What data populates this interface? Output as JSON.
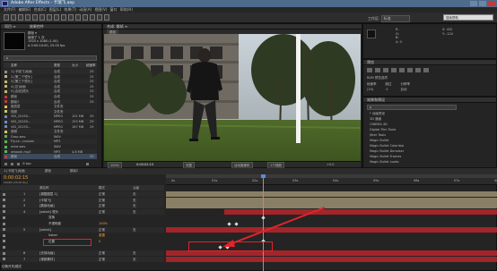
{
  "titlebar": {
    "title": "Adobe After Effects - 卡瑞飞.aep"
  },
  "menubar": {
    "text": "文件(F) 编辑(E) 合成(C) 图层(L) 效果(T) 动画(A) 视图(V) 窗口 帮助(H)"
  },
  "toolbar": {
    "workspace_label": "工作区:",
    "workspace_value": "标准",
    "search_placeholder": "搜索帮助"
  },
  "project": {
    "tab": "项目 ≡",
    "tab2": "效果控件",
    "selected_name": "跳帧 ▾",
    "selected_info": "使用了 1 次",
    "selected_dims": "1920 x 1080 (1.00)",
    "selected_dur": "Δ 0:00:10:00, 25.00 fps",
    "search_placeholder": "ρ",
    "col_name": "名称",
    "col_type": "类型",
    "col_size": "大小",
    "col_rate": "帧速率",
    "items": [
      {
        "name": "1.[卡瑞飞]动画",
        "type": "合成",
        "size": "",
        "rate": "25",
        "color": "#8e8e8e"
      },
      {
        "name": "2.[第二个镜头]",
        "type": "合成",
        "size": "",
        "rate": "25",
        "color": "#c8b46a"
      },
      {
        "name": "3.[第三个镜头]",
        "type": "合成",
        "size": "",
        "rate": "25",
        "color": "#c8b46a"
      },
      {
        "name": "4.[总]动画",
        "type": "合成",
        "size": "",
        "rate": "25",
        "color": "#c8b46a"
      },
      {
        "name": "5.[合成]镜头",
        "type": "合成",
        "size": "",
        "rate": "25",
        "color": "#c8b46a"
      },
      {
        "name": "跳帧",
        "type": "合成",
        "size": "",
        "rate": "25",
        "color": "#c23b3b"
      },
      {
        "name": "跳帧2",
        "type": "合成",
        "size": "",
        "rate": "25",
        "color": "#c23b3b"
      },
      {
        "name": "固态层",
        "type": "文件夹",
        "size": "",
        "rate": "",
        "color": "#d8c35a"
      },
      {
        "name": "视频",
        "type": "文件夹",
        "size": "",
        "rate": "",
        "color": "#d8c35a"
      },
      {
        "name": "VID_20150...",
        "type": "MPEG",
        "size": "101 MB",
        "rate": "29",
        "color": "#6a8cc8"
      },
      {
        "name": "VID_20150...",
        "type": "MPEG",
        "size": "153 MB",
        "rate": "29",
        "color": "#6a8cc8"
      },
      {
        "name": "VID_20150...",
        "type": "MPEG",
        "size": "187 MB",
        "rate": "29",
        "color": "#6a8cc8"
      },
      {
        "name": "音频",
        "type": "文件夹",
        "size": "",
        "rate": "",
        "color": "#d8c35a"
      },
      {
        "name": "Drop.wav",
        "type": "WAV",
        "size": "",
        "rate": "",
        "color": "#5ab45a"
      },
      {
        "name": "Fly.ce...cussion",
        "type": "MP3",
        "size": "",
        "rate": "",
        "color": "#5ab45a"
      },
      {
        "name": "wind.wav",
        "type": "WAV",
        "size": "",
        "rate": "",
        "color": "#5ab45a"
      },
      {
        "name": "whoosh.mp3",
        "type": "MP3",
        "size": "4.8 MB",
        "rate": "",
        "color": "#5ab45a"
      },
      {
        "name": "跳帧",
        "type": "合成",
        "size": "",
        "rate": "25",
        "color": "#c23b3b"
      }
    ],
    "bpc": "8 bpc"
  },
  "composition": {
    "tab": "合成: 跳帧 ≡",
    "crumb": "跳帧",
    "zoom": "100%",
    "timecode": "0:00:02:15",
    "resolution": "完整",
    "camera": "活动摄像机",
    "views": "1个视图",
    "offset": "+0.0"
  },
  "info": {
    "r": "R: ",
    "g": "G: ",
    "b": "B: ",
    "a": "A: 0",
    "x": "X: 432",
    "y": "Y: -124"
  },
  "preview": {
    "tab": "预览",
    "rate_label": "帧速率",
    "skip_label": "跳过",
    "res_label": "分辨率",
    "rate_val": "(25)",
    "skip_val": "0",
    "res_val": "自动",
    "shortcut": "RAM 预览选项"
  },
  "effects": {
    "tab": "效果和预设",
    "search_placeholder": "ρ",
    "items": [
      "* 动画预设",
      "3D 通道",
      "CINEMA 4D",
      "Digital Film Tools",
      "Jitter Tools",
      "Magic Bullet",
      "Magic Bullet Colorista",
      "Magic Bullet Denoiser",
      "Magic Bullet Frames",
      "Magic Bullet Looks"
    ]
  },
  "timeline": {
    "tabs": [
      "1.[卡瑞飞]动画",
      "跳帧",
      "跳帧2"
    ],
    "timecode": "0:00:02:15",
    "fps_info": "00065 (25.00 fps)",
    "col_source": "源名称",
    "col_mode": "模式",
    "col_parent": "父级",
    "ticks": [
      "0s",
      "01s",
      "02s",
      "03s",
      "04s",
      "05s",
      "06s",
      "07s",
      "08s"
    ],
    "layers": [
      {
        "num": "1",
        "name": "[调整图层 1]",
        "mode": "正常",
        "parent": "无"
      },
      {
        "num": "2",
        "name": "[卡瑞飞]",
        "mode": "正常",
        "parent": "无"
      },
      {
        "num": "3",
        "name": "[跳帧动画]",
        "mode": "正常",
        "parent": "无"
      },
      {
        "num": "4",
        "name": "[select] 镜头",
        "mode": "正常",
        "parent": "无"
      },
      {
        "num": "",
        "name": "变换",
        "mode": "",
        "parent": ""
      },
      {
        "num": "",
        "name": "不透明度",
        "mode": "100%",
        "parent": ""
      },
      {
        "num": "5",
        "name": "[select]",
        "mode": "正常",
        "parent": "无"
      },
      {
        "num": "",
        "name": "Saber",
        "mode": "重置",
        "parent": ""
      },
      {
        "num": "",
        "name": "位置",
        "mode": "0",
        "parent": ""
      },
      {
        "num": "",
        "name": "",
        "mode": "",
        "parent": ""
      },
      {
        "num": "6",
        "name": "[光效动画]",
        "mode": "正常",
        "parent": "无"
      },
      {
        "num": "7",
        "name": "[视频素材]",
        "mode": "正常",
        "parent": "无"
      }
    ],
    "toggle_label": "切换开关/模式"
  },
  "colors": {
    "layer_red": "#b8262b",
    "layer_tan": "#9b8f72",
    "annotation_red": "#e0242c",
    "playhead": "#e07a6a",
    "timecode_orange": "#e8a13a"
  }
}
